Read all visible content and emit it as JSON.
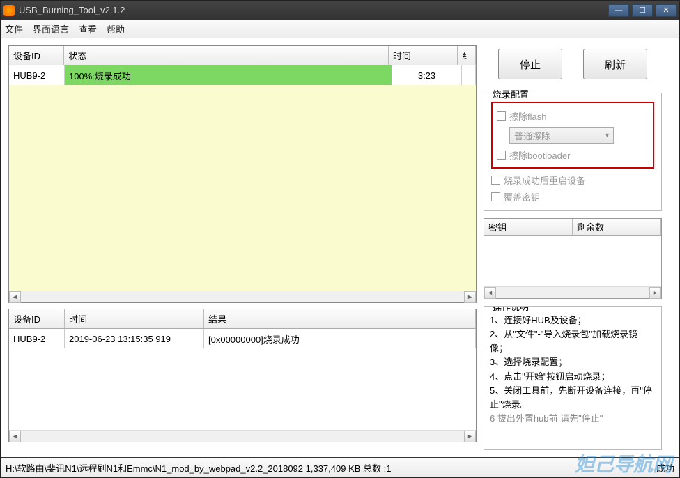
{
  "window": {
    "title": "USB_Burning_Tool_v2.1.2"
  },
  "menus": {
    "file": "文件",
    "lang": "界面语言",
    "view": "查看",
    "help": "帮助"
  },
  "grid1": {
    "headers": {
      "device_id": "设备ID",
      "status": "状态",
      "time": "时间",
      "trailing": "纟"
    },
    "row": {
      "device_id": "HUB9-2",
      "status": "100%:烧录成功",
      "time": "3:23"
    }
  },
  "grid2": {
    "headers": {
      "device_id": "设备ID",
      "time": "时间",
      "result": "结果"
    },
    "row": {
      "device_id": "HUB9-2",
      "time": "2019-06-23 13:15:35 919",
      "result": "[0x00000000]烧录成功"
    }
  },
  "buttons": {
    "stop": "停止",
    "refresh": "刷新"
  },
  "config": {
    "legend": "烧录配置",
    "erase_flash": "擦除flash",
    "erase_mode": "普通擦除",
    "erase_bootloader": "擦除bootloader",
    "reboot_after": "烧录成功后重启设备",
    "overwrite_key": "覆盖密钥"
  },
  "keytable": {
    "col_key": "密钥",
    "col_remain": "剩余数"
  },
  "instructions": {
    "legend": "操作说明",
    "line1": "1、连接好HUB及设备；",
    "line2": "2、从\"文件\"-\"导入烧录包\"加载烧录镜像；",
    "line3": "3、选择烧录配置；",
    "line4": "4、点击\"开始\"按钮启动烧录；",
    "line5": "5、关闭工具前，先断开设备连接，再\"停止\"烧录。",
    "line6": "6   拔出外置hub前   请先\"停止\""
  },
  "statusbar": {
    "path": "H:\\软路由\\斐讯N1\\远程刷N1和Emmc\\N1_mod_by_webpad_v2.2_2018092 1,337,409 KB   总数 :1",
    "success": "成功"
  },
  "watermark": "妲己导航网"
}
